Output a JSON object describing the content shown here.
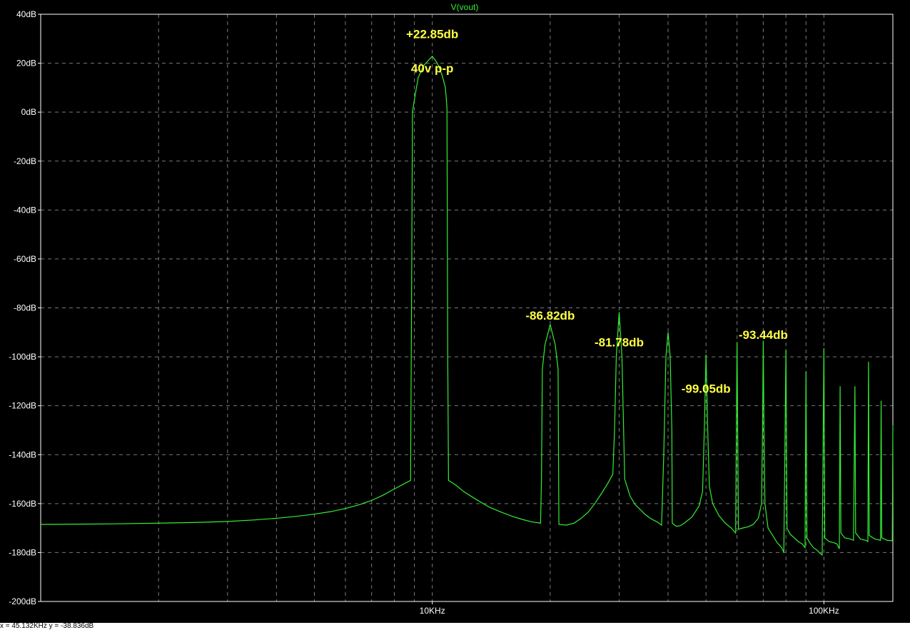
{
  "status_bar": {
    "cursor_text": "x = 45.132KHz  y = -38.836dB"
  },
  "colors": {
    "background": "#000000",
    "trace": "#33ee33",
    "annotation": "#ffff44",
    "grid": "#7a7a7a",
    "frame": "#ffffff"
  },
  "chart_data": {
    "type": "line",
    "title": "V(vout)",
    "xlabel": "",
    "ylabel": "",
    "x_scale": "log",
    "x_unit": "Hz",
    "xlim": [
      1000,
      150000
    ],
    "ylim": [
      -200,
      40
    ],
    "x_tick_labels": [
      {
        "x": 10000,
        "label": "10KHz"
      },
      {
        "x": 100000,
        "label": "100KHz"
      }
    ],
    "y_ticks": [
      40,
      20,
      0,
      -20,
      -40,
      -60,
      -80,
      -100,
      -120,
      -140,
      -160,
      -180,
      -200
    ],
    "y_tick_labels": [
      "40dB",
      "20dB",
      "0dB",
      "-20dB",
      "-40dB",
      "-60dB",
      "-80dB",
      "-100dB",
      "-120dB",
      "-140dB",
      "-160dB",
      "-180dB",
      "-200dB"
    ],
    "grid": true,
    "series": [
      {
        "name": "V(vout)",
        "points": [
          [
            1000,
            -168.5
          ],
          [
            1500,
            -168.3
          ],
          [
            2000,
            -168.0
          ],
          [
            2500,
            -167.7
          ],
          [
            3000,
            -167.3
          ],
          [
            3500,
            -166.7
          ],
          [
            4000,
            -166.0
          ],
          [
            4500,
            -165.2
          ],
          [
            5000,
            -164.3
          ],
          [
            5500,
            -163.3
          ],
          [
            6000,
            -162.0
          ],
          [
            6500,
            -160.5
          ],
          [
            7000,
            -158.7
          ],
          [
            7500,
            -156.5
          ],
          [
            8000,
            -154.0
          ],
          [
            8500,
            -151.8
          ],
          [
            8800,
            -150.5
          ],
          [
            8850,
            -80
          ],
          [
            8900,
            0
          ],
          [
            9000,
            5
          ],
          [
            9200,
            14
          ],
          [
            9500,
            19
          ],
          [
            10000,
            22.85
          ],
          [
            10300,
            20
          ],
          [
            10600,
            15
          ],
          [
            10800,
            10
          ],
          [
            10900,
            2
          ],
          [
            10950,
            -100
          ],
          [
            11000,
            -150.5
          ],
          [
            11500,
            -152.5
          ],
          [
            12000,
            -155
          ],
          [
            13000,
            -158.5
          ],
          [
            14000,
            -161.5
          ],
          [
            15000,
            -163.5
          ],
          [
            16000,
            -165.2
          ],
          [
            17000,
            -166.5
          ],
          [
            18000,
            -167.5
          ],
          [
            18900,
            -168.0
          ],
          [
            19000,
            -150
          ],
          [
            19100,
            -105
          ],
          [
            19400,
            -95
          ],
          [
            20000,
            -86.82
          ],
          [
            20600,
            -95
          ],
          [
            20950,
            -105
          ],
          [
            21050,
            -168.5
          ],
          [
            22000,
            -168.8
          ],
          [
            23000,
            -168.0
          ],
          [
            24000,
            -166.0
          ],
          [
            25000,
            -163.5
          ],
          [
            26000,
            -160.0
          ],
          [
            27000,
            -156.0
          ],
          [
            28000,
            -152.0
          ],
          [
            28900,
            -148.0
          ],
          [
            29200,
            -130
          ],
          [
            29500,
            -100
          ],
          [
            30000,
            -81.78
          ],
          [
            30500,
            -100
          ],
          [
            30800,
            -130
          ],
          [
            31000,
            -150
          ],
          [
            32000,
            -157.0
          ],
          [
            33000,
            -160.5
          ],
          [
            34000,
            -162.5
          ],
          [
            35000,
            -164.5
          ],
          [
            36000,
            -166.0
          ],
          [
            37500,
            -167.5
          ],
          [
            38500,
            -168.8
          ],
          [
            39000,
            -140
          ],
          [
            39500,
            -100
          ],
          [
            40000,
            -90
          ],
          [
            40500,
            -100
          ],
          [
            40900,
            -130
          ],
          [
            41000,
            -168.0
          ],
          [
            42000,
            -169.3
          ],
          [
            43000,
            -169.0
          ],
          [
            44000,
            -168.0
          ],
          [
            46000,
            -165.5
          ],
          [
            48000,
            -161.0
          ],
          [
            49000,
            -155
          ],
          [
            49500,
            -130
          ],
          [
            50000,
            -99.05
          ],
          [
            50500,
            -130
          ],
          [
            51000,
            -153
          ],
          [
            52000,
            -160
          ],
          [
            54000,
            -165
          ],
          [
            56000,
            -168.0
          ],
          [
            58000,
            -170.0
          ],
          [
            59500,
            -172.0
          ],
          [
            60000,
            -94
          ],
          [
            60500,
            -170.5
          ],
          [
            62000,
            -170.0
          ],
          [
            64000,
            -169.5
          ],
          [
            66000,
            -168.5
          ],
          [
            68000,
            -166.0
          ],
          [
            69300,
            -160.0
          ],
          [
            69700,
            -130
          ],
          [
            70000,
            -93.44
          ],
          [
            70300,
            -130
          ],
          [
            70700,
            -160
          ],
          [
            72000,
            -170.0
          ],
          [
            74000,
            -173.0
          ],
          [
            76000,
            -176.0
          ],
          [
            78000,
            -178.0
          ],
          [
            79000,
            -180.0
          ],
          [
            80000,
            -97
          ],
          [
            80500,
            -170
          ],
          [
            82000,
            -172.5
          ],
          [
            84000,
            -174.0
          ],
          [
            86000,
            -175.5
          ],
          [
            88000,
            -176.5
          ],
          [
            89500,
            -178.0
          ],
          [
            90000,
            -106
          ],
          [
            90500,
            -174.0
          ],
          [
            92000,
            -176.0
          ],
          [
            94000,
            -178.0
          ],
          [
            96000,
            -179.0
          ],
          [
            98000,
            -180.5
          ],
          [
            99000,
            -181.0
          ],
          [
            100000,
            -96.5
          ],
          [
            100500,
            -174
          ],
          [
            103000,
            -175.5
          ],
          [
            106000,
            -176.0
          ],
          [
            108000,
            -176.5
          ],
          [
            109500,
            -178.5
          ],
          [
            110000,
            -112
          ],
          [
            110500,
            -172
          ],
          [
            113000,
            -174.0
          ],
          [
            117000,
            -174.5
          ],
          [
            119000,
            -175.0
          ],
          [
            120000,
            -112
          ],
          [
            120500,
            -172
          ],
          [
            124000,
            -174.5
          ],
          [
            128000,
            -175.0
          ],
          [
            129500,
            -175.5
          ],
          [
            130000,
            -102
          ],
          [
            130500,
            -173
          ],
          [
            135000,
            -174.5
          ],
          [
            139500,
            -175.0
          ],
          [
            140000,
            -118
          ],
          [
            140500,
            -174
          ],
          [
            145000,
            -175.0
          ],
          [
            149500,
            -175.2
          ],
          [
            150000,
            -128
          ]
        ]
      }
    ],
    "annotations": [
      {
        "text": "+22.85db",
        "x": 10000,
        "y": 32
      },
      {
        "text": "40v p-p",
        "x": 10000,
        "y": 18
      },
      {
        "text": "-86.82db",
        "x": 20000,
        "y": -83
      },
      {
        "text": "-81.78db",
        "x": 30000,
        "y": -94
      },
      {
        "text": "-99.05db",
        "x": 50000,
        "y": -113
      },
      {
        "text": "-93.44db",
        "x": 70000,
        "y": -91
      }
    ]
  }
}
